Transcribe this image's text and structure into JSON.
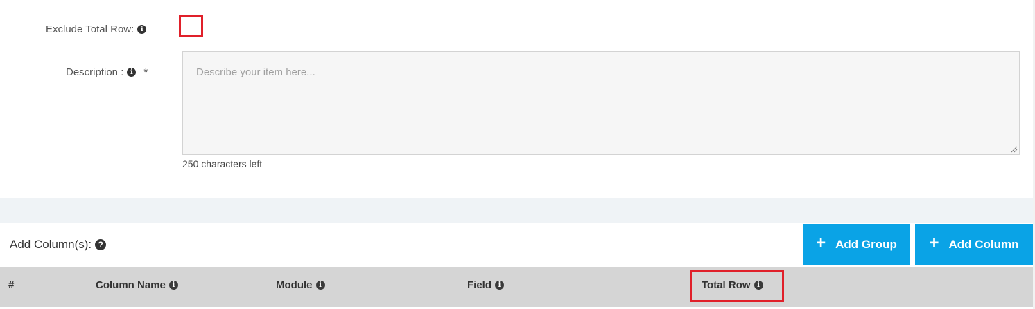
{
  "form": {
    "exclude_total_label": "Exclude Total Row:",
    "description_label": "Description :",
    "required_mark": "*",
    "description_placeholder": "Describe your item here...",
    "chars_left": "250 characters left"
  },
  "columns": {
    "title": "Add Column(s):",
    "add_group_label": "Add Group",
    "add_column_label": "Add Column",
    "headers": [
      "#",
      "Column Name",
      "Module",
      "Field",
      "Total Row"
    ]
  },
  "colors": {
    "button": "#0aa3e6",
    "highlight": "#e0202a",
    "table_header": "#d5d5d5"
  },
  "icons": [
    "info-icon",
    "question-circle-icon",
    "plus-icon",
    "resize-grip-icon"
  ]
}
